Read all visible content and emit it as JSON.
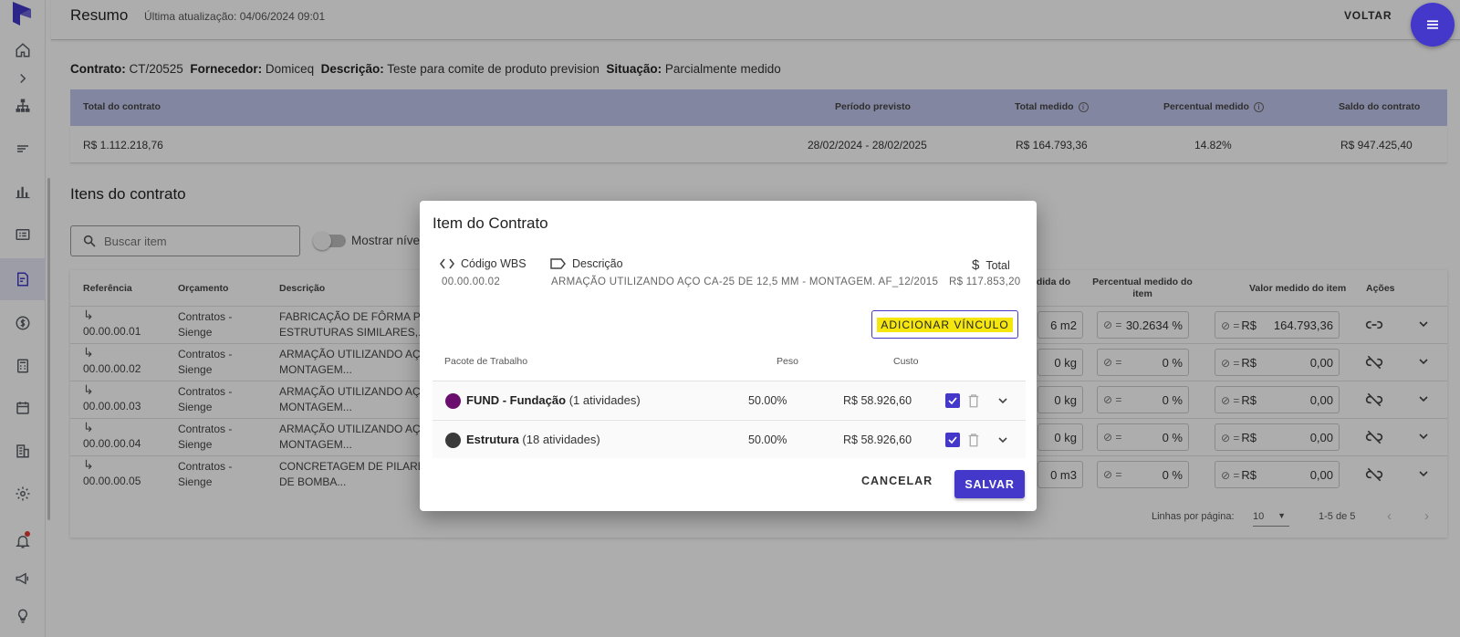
{
  "header": {
    "title": "Resumo",
    "last_update": "Última atualização: 04/06/2024 09:01",
    "back_label": "VOLTAR"
  },
  "contract": {
    "contrato_label": "Contrato:",
    "contrato_value": "CT/20525",
    "fornecedor_label": "Fornecedor:",
    "fornecedor_value": "Domiceq",
    "descricao_label": "Descrição:",
    "descricao_value": "Teste para comite de produto prevision",
    "situacao_label": "Situação:",
    "situacao_value": "Parcialmente medido"
  },
  "summary": {
    "headers": [
      "Total do contrato",
      "Período previsto",
      "Total medido",
      "Percentual medido",
      "Saldo do contrato"
    ],
    "values": [
      "R$ 1.112.218,76",
      "28/02/2024 - 28/02/2025",
      "R$ 164.793,36",
      "14.82%",
      "R$ 947.425,40"
    ]
  },
  "items": {
    "title": "Itens do contrato",
    "search_placeholder": "Buscar item",
    "toggle_label": "Mostrar níve",
    "headers": {
      "referencia": "Referência",
      "orcamento": "Orçamento",
      "descricao": "Descrição",
      "qtd": "edida do",
      "percentual": "Percentual medido do item",
      "valor": "Valor medido do item",
      "acoes": "Ações"
    },
    "rows": [
      {
        "ref": "00.00.00.01",
        "orc1": "Contratos -",
        "orc2": "Sienge",
        "desc1": "FABRICAÇÃO DE FÔRMA PAR",
        "desc2": "ESTRUTURAS SIMILARES,...",
        "qty": "6 m2",
        "pct": "30.2634 %",
        "cur": "R$",
        "val": "164.793,36"
      },
      {
        "ref": "00.00.00.02",
        "orc1": "Contratos -",
        "orc2": "Sienge",
        "desc1": "ARMAÇÃO UTILIZANDO AÇO",
        "desc2": "MONTAGEM...",
        "qty": "0 kg",
        "pct": "0 %",
        "cur": "R$",
        "val": "0,00"
      },
      {
        "ref": "00.00.00.03",
        "orc1": "Contratos -",
        "orc2": "Sienge",
        "desc1": "ARMAÇÃO UTILIZANDO AÇO",
        "desc2": "MONTAGEM...",
        "qty": "0 kg",
        "pct": "0 %",
        "cur": "R$",
        "val": "0,00"
      },
      {
        "ref": "00.00.00.04",
        "orc1": "Contratos -",
        "orc2": "Sienge",
        "desc1": "ARMAÇÃO UTILIZANDO AÇO",
        "desc2": "MONTAGEM...",
        "qty": "0 kg",
        "pct": "0 %",
        "cur": "R$",
        "val": "0,00"
      },
      {
        "ref": "00.00.00.05",
        "orc1": "Contratos -",
        "orc2": "Sienge",
        "desc1": "CONCRETAGEM DE PILARES,",
        "desc2": "DE BOMBA...",
        "qty": "0 m3",
        "pct": "0 %",
        "cur": "R$",
        "val": "0,00"
      }
    ],
    "pager": {
      "rows_label": "Linhas por página:",
      "rows_value": "10",
      "range": "1-5 de 5"
    }
  },
  "modal": {
    "title": "Item do Contrato",
    "wbs_label": "Código WBS",
    "wbs_value": "00.00.00.02",
    "desc_label": "Descrição",
    "desc_value": "ARMAÇÃO UTILIZANDO AÇO CA-25 DE 12,5 MM - MONTAGEM. AF_12/2015",
    "total_label": "Total",
    "total_value": "R$ 117.853,20",
    "add_link_label": "ADICIONAR VÍNCULO",
    "table_headers": {
      "pacote": "Pacote de Trabalho",
      "peso": "Peso",
      "custo": "Custo"
    },
    "packages": [
      {
        "name": "FUND - Fundação",
        "detail": "(1 atividades)",
        "peso": "50.00%",
        "custo": "R$ 58.926,60",
        "color": "#6a0f6d"
      },
      {
        "name": "Estrutura",
        "detail": "(18 atividades)",
        "peso": "50.00%",
        "custo": "R$ 58.926,60",
        "color": "#3a3a3a"
      }
    ],
    "cancel_label": "CANCELAR",
    "save_label": "SALVAR"
  },
  "colors": {
    "accent": "#4338ca",
    "highlight": "#f5e60f",
    "summary_header": "#c1c6ec"
  }
}
